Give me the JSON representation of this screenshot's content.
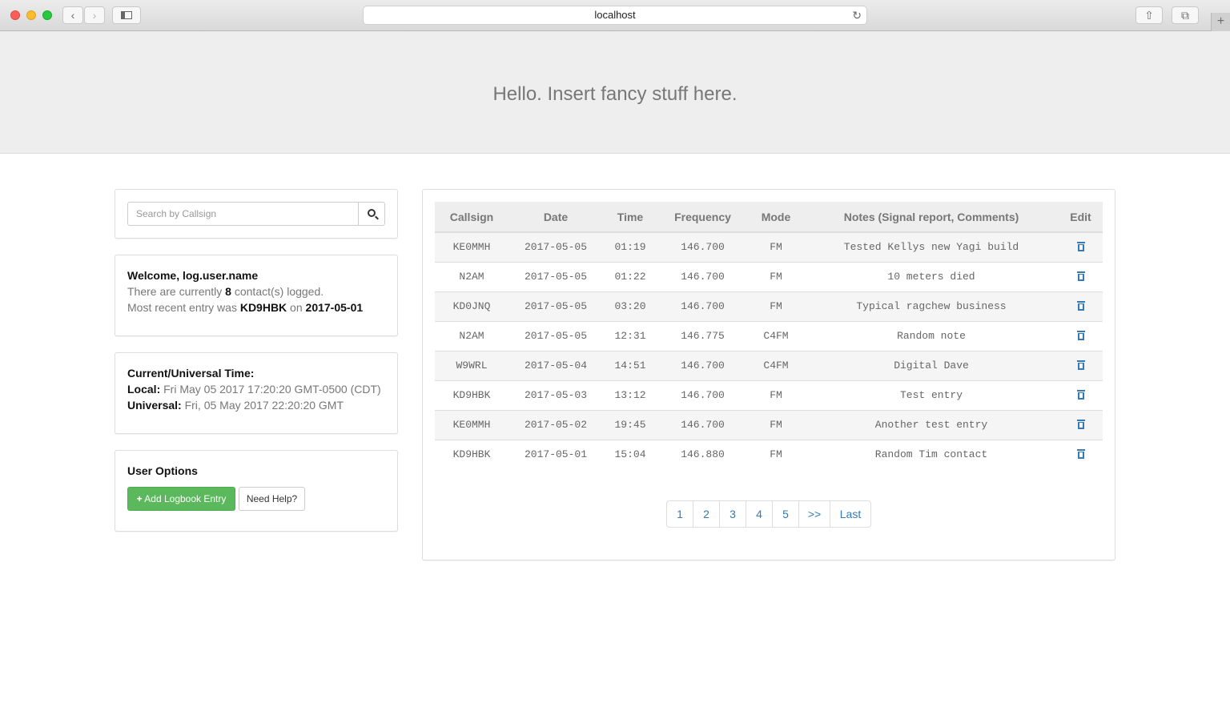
{
  "browser": {
    "url": "localhost"
  },
  "hero": {
    "text": "Hello. Insert fancy stuff here."
  },
  "search": {
    "placeholder": "Search by Callsign"
  },
  "welcome": {
    "heading": "Welcome, log.user.name",
    "count_prefix": "There are currently ",
    "count": "8",
    "count_suffix": " contact(s) logged.",
    "recent_prefix": "Most recent entry was ",
    "recent_callsign": "KD9HBK",
    "recent_on": " on ",
    "recent_date": "2017-05-01"
  },
  "time": {
    "heading": "Current/Universal Time:",
    "local_label": "Local:",
    "local_value": "Fri May 05 2017 17:20:20 GMT-0500 (CDT)",
    "universal_label": "Universal:",
    "universal_value": "Fri, 05 May 2017 22:20:20 GMT"
  },
  "options": {
    "heading": "User Options",
    "add_label": "Add Logbook Entry",
    "help_label": "Need Help?"
  },
  "table": {
    "headers": [
      "Callsign",
      "Date",
      "Time",
      "Frequency",
      "Mode",
      "Notes (Signal report, Comments)",
      "Edit"
    ],
    "rows": [
      [
        "KE0MMH",
        "2017-05-05",
        "01:19",
        "146.700",
        "FM",
        "Tested Kellys new Yagi build"
      ],
      [
        "N2AM",
        "2017-05-05",
        "01:22",
        "146.700",
        "FM",
        "10 meters died"
      ],
      [
        "KD0JNQ",
        "2017-05-05",
        "03:20",
        "146.700",
        "FM",
        "Typical ragchew business"
      ],
      [
        "N2AM",
        "2017-05-05",
        "12:31",
        "146.775",
        "C4FM",
        "Random note"
      ],
      [
        "W9WRL",
        "2017-05-04",
        "14:51",
        "146.700",
        "C4FM",
        "Digital Dave"
      ],
      [
        "KD9HBK",
        "2017-05-03",
        "13:12",
        "146.700",
        "FM",
        "Test entry"
      ],
      [
        "KE0MMH",
        "2017-05-02",
        "19:45",
        "146.700",
        "FM",
        "Another test entry"
      ],
      [
        "KD9HBK",
        "2017-05-01",
        "15:04",
        "146.880",
        "FM",
        "Random Tim contact"
      ]
    ]
  },
  "pagination": [
    "1",
    "2",
    "3",
    "4",
    "5",
    ">>",
    "Last"
  ],
  "colors": {
    "link": "#337ab7",
    "success": "#5cb85c",
    "hero_bg": "#eeeeee"
  }
}
